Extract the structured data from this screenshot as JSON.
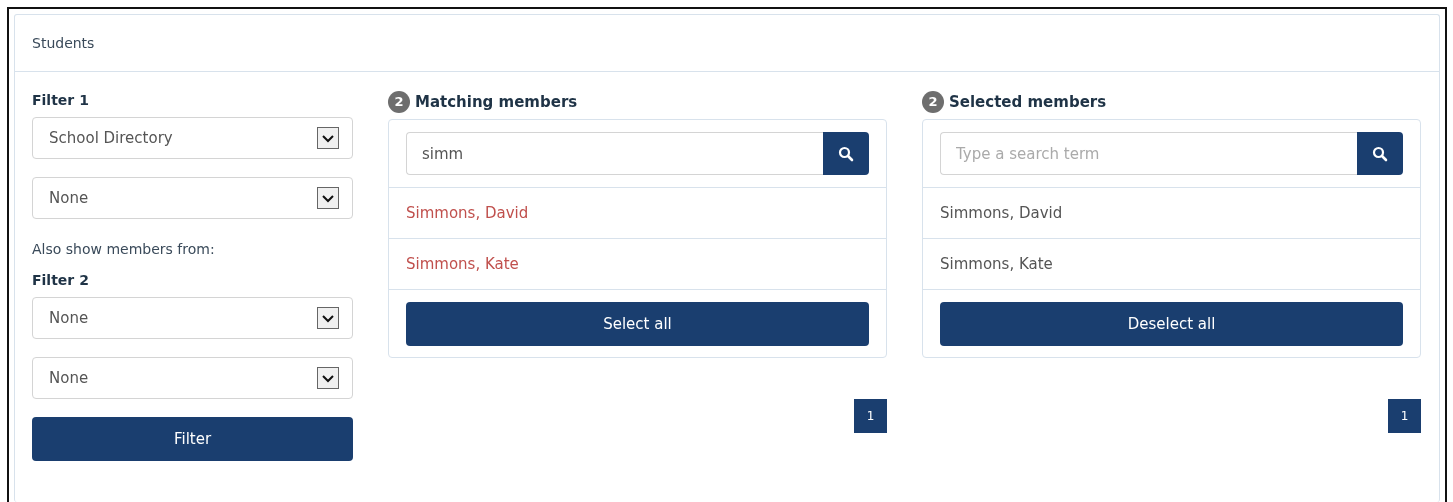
{
  "panel": {
    "title": "Students"
  },
  "filters": {
    "filter1": {
      "label": "Filter 1",
      "selects": [
        "School Directory",
        "None"
      ]
    },
    "also_label": "Also show members from:",
    "filter2": {
      "label": "Filter 2",
      "selects": [
        "None",
        "None"
      ]
    },
    "button": "Filter"
  },
  "lists": [
    {
      "count": "2",
      "title": "Matching members",
      "search": {
        "value": "simm"
      },
      "items": [
        {
          "name": "Simmons, David",
          "selected": true
        },
        {
          "name": "Simmons, Kate",
          "selected": true
        }
      ],
      "button": "Select all",
      "pages": [
        {
          "label": "1",
          "selected": true
        }
      ]
    },
    {
      "count": "2",
      "title": "Selected members",
      "search": {
        "placeholder": "Type a search term"
      },
      "items": [
        {
          "name": "Simmons, David",
          "selected": false
        },
        {
          "name": "Simmons, Kate",
          "selected": false
        }
      ],
      "button": "Deselect all",
      "pages": [
        {
          "label": "1",
          "selected": true
        }
      ]
    }
  ]
}
